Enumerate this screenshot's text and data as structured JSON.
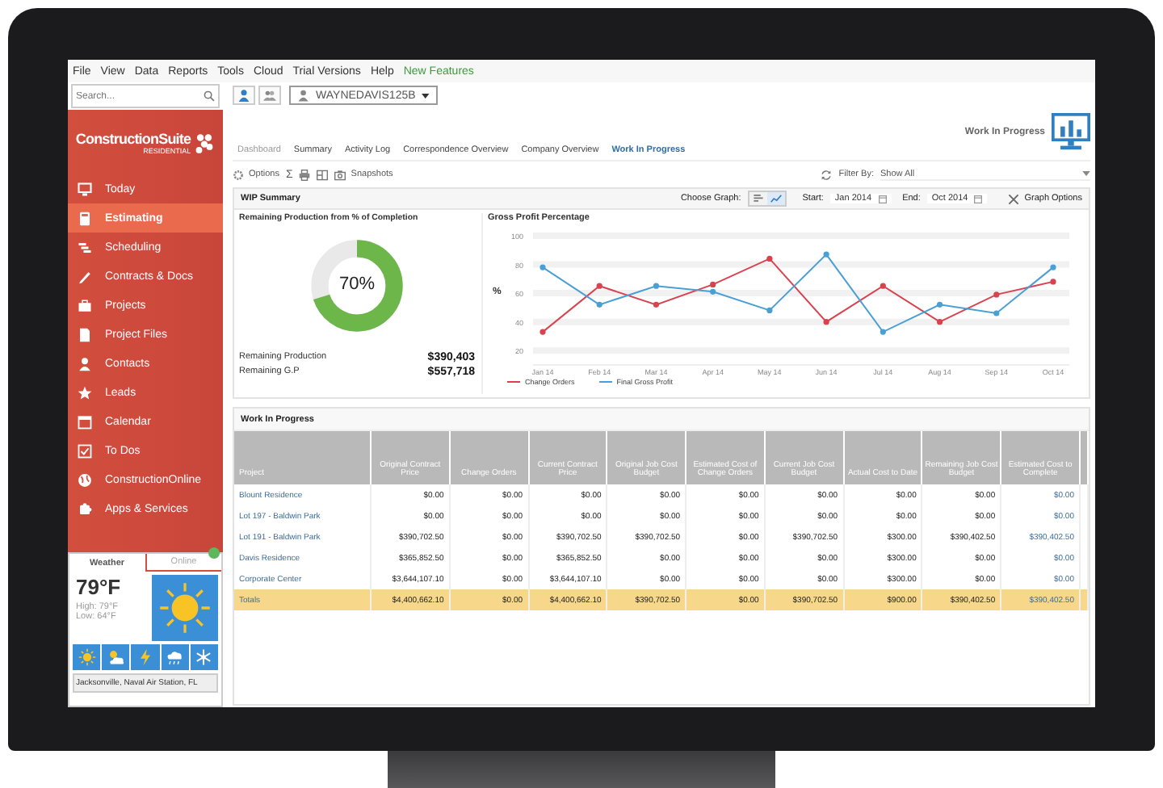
{
  "menu": [
    {
      "label": "File",
      "color": "#333333"
    },
    {
      "label": "View",
      "color": "#333333"
    },
    {
      "label": "Data",
      "color": "#333333"
    },
    {
      "label": "Reports",
      "color": "#333333"
    },
    {
      "label": "Tools",
      "color": "#333333"
    },
    {
      "label": "Cloud",
      "color": "#333333"
    },
    {
      "label": "Trial Versions",
      "color": "#333333"
    },
    {
      "label": "Help",
      "color": "#333333"
    },
    {
      "label": "New Features",
      "color": "#3d9a3d"
    }
  ],
  "search": {
    "placeholder": "Search..."
  },
  "logo": {
    "title": "ConstructionSuite",
    "subtitle": "RESIDENTIAL"
  },
  "nav": [
    {
      "label": "Today",
      "selected": false
    },
    {
      "label": "Estimating",
      "selected": true
    },
    {
      "label": "Scheduling",
      "selected": false
    },
    {
      "label": "Contracts & Docs",
      "selected": false
    },
    {
      "label": "Projects",
      "selected": false
    },
    {
      "label": "Project Files",
      "selected": false
    },
    {
      "label": "Contacts",
      "selected": false
    },
    {
      "label": "Leads",
      "selected": false
    },
    {
      "label": "Calendar",
      "selected": false
    },
    {
      "label": "To Dos",
      "selected": false
    },
    {
      "label": "ConstructionOnline",
      "selected": false
    },
    {
      "label": "Apps & Services",
      "selected": false
    }
  ],
  "weather": {
    "tabs": [
      {
        "label": "Weather",
        "selected": true
      },
      {
        "label": "Online",
        "selected": false
      }
    ],
    "temperature": "79°F",
    "high": "High: 79°F",
    "low": "Low: 64°F",
    "location": "Jacksonville, Naval Air Station, FL"
  },
  "user": {
    "name": "WAYNEDAVIS125B"
  },
  "page_title": "Work In Progress",
  "tabs": [
    {
      "label": "Dashboard",
      "selected": false
    },
    {
      "label": "Summary",
      "selected": false
    },
    {
      "label": "Activity Log",
      "selected": false
    },
    {
      "label": "Correspondence Overview",
      "selected": false
    },
    {
      "label": "Company Overview",
      "selected": false
    },
    {
      "label": "Work In Progress",
      "selected": true
    }
  ],
  "toolbar": {
    "options": "Options",
    "sigma": "Σ",
    "snapshots": "Snapshots",
    "filter_label": "Filter By:",
    "filter_value": "Show All"
  },
  "wip_summary": {
    "title": "WIP Summary",
    "choose_graph": "Choose Graph:",
    "graph_types": [
      {
        "kind": "bar",
        "selected": false
      },
      {
        "kind": "line",
        "selected": true
      }
    ],
    "start_label": "Start:",
    "start": "Jan 2014",
    "end_label": "End:",
    "end": "Oct 2014",
    "graph_options": "Graph Options",
    "donut": {
      "title": "Remaining Production from % of Completion",
      "level": 0.7,
      "label": "70%"
    },
    "totals": [
      {
        "label": "Remaining Production",
        "value": "$390,403"
      },
      {
        "label": "Remaining G.P",
        "value": "$557,718"
      }
    ],
    "chart": {
      "chart_data": {
        "type": "line",
        "title": "Gross Profit Percentage",
        "ylabel": "%",
        "categories": [
          "Jan 14",
          "Feb 14",
          "Mar 14",
          "Apr 14",
          "May 14",
          "Jun 14",
          "Jul 14",
          "Aug 14",
          "Sep 14",
          "Oct 14"
        ],
        "ylim": [
          10,
          100
        ],
        "yticks": [
          20,
          40,
          60,
          80,
          100
        ],
        "grid": true,
        "legend": "bottom",
        "series": [
          {
            "name": "Change Orders",
            "color": "#d9434f",
            "marker": "circle",
            "values": [
              33,
              65,
              52,
              66,
              84,
              40,
              65,
              40,
              59,
              68
            ]
          },
          {
            "name": "Final Gross Profit",
            "color": "#4a9fd4",
            "marker": "circle",
            "values": [
              78,
              52,
              65,
              61,
              48,
              87,
              33,
              52,
              46,
              78
            ]
          }
        ]
      }
    }
  },
  "table": {
    "title": "Work In Progress",
    "columns": [
      "Project",
      "Original Contract Price",
      "Change Orders",
      "Current Contract Price",
      "Original Job Cost Budget",
      "Estimated Cost of Change Orders",
      "Current Job Cost Budget",
      "Actual Cost to Date",
      "Remaining Job Cost Budget",
      "Estimated Cost to Complete"
    ],
    "rows": [
      {
        "highlighted": false,
        "cells": [
          "Blount Residence",
          "$0.00",
          "$0.00",
          "$0.00",
          "$0.00",
          "$0.00",
          "$0.00",
          "$0.00",
          "$0.00",
          "$0.00"
        ]
      },
      {
        "highlighted": false,
        "cells": [
          "Lot 197 - Baldwin Park",
          "$0.00",
          "$0.00",
          "$0.00",
          "$0.00",
          "$0.00",
          "$0.00",
          "$0.00",
          "$0.00",
          "$0.00"
        ]
      },
      {
        "highlighted": false,
        "cells": [
          "Lot 191 - Baldwin Park",
          "$390,702.50",
          "$0.00",
          "$390,702.50",
          "$390,702.50",
          "$0.00",
          "$390,702.50",
          "$300.00",
          "$390,402.50",
          "$390,402.50"
        ]
      },
      {
        "highlighted": false,
        "cells": [
          "Davis Residence",
          "$365,852.50",
          "$0.00",
          "$365,852.50",
          "$0.00",
          "$0.00",
          "$0.00",
          "$300.00",
          "$0.00",
          "$0.00"
        ]
      },
      {
        "highlighted": false,
        "cells": [
          "Corporate Center",
          "$3,644,107.10",
          "$0.00",
          "$3,644,107.10",
          "$0.00",
          "$0.00",
          "$0.00",
          "$300.00",
          "$0.00",
          "$0.00"
        ]
      },
      {
        "highlighted": true,
        "cells": [
          "Totals",
          "$4,400,662.10",
          "$0.00",
          "$4,400,662.10",
          "$390,702.50",
          "$0.00",
          "$390,702.50",
          "$900.00",
          "$390,402.50",
          "$390,402.50"
        ]
      }
    ]
  }
}
